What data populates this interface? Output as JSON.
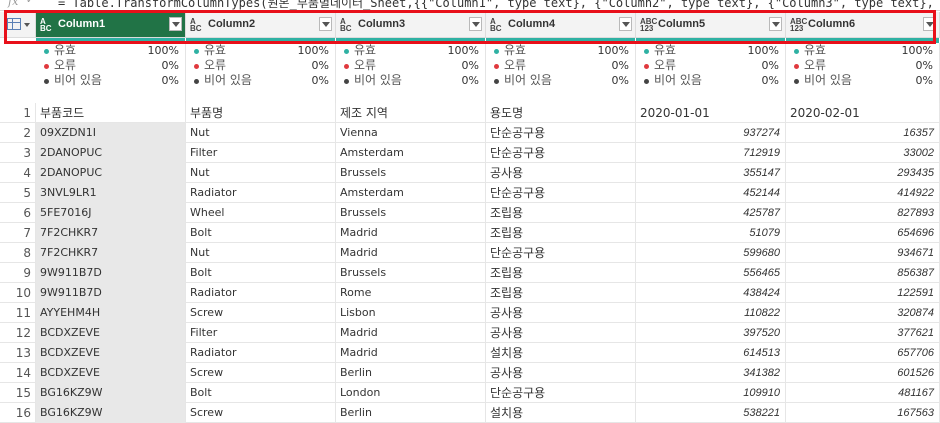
{
  "formula": {
    "fx": "fx",
    "text": "= Table.TransformColumnTypes(원본_부품별데이터_Sheet,{{\"Column1\", type text}, {\"Column2\", type text}, {\"Column3\", type text}, {\"Column4\", type text},"
  },
  "columns": [
    {
      "name": "Column1",
      "type_line1": "A",
      "type_line2": "BC",
      "type_icon": "text-type-icon"
    },
    {
      "name": "Column2",
      "type_line1": "A",
      "type_line2": "BC",
      "type_icon": "text-type-icon"
    },
    {
      "name": "Column3",
      "type_line1": "A",
      "type_line2": "BC",
      "type_icon": "text-type-icon"
    },
    {
      "name": "Column4",
      "type_line1": "A",
      "type_line2": "BC",
      "type_icon": "text-type-icon"
    },
    {
      "name": "Column5",
      "type_line1": "ABC",
      "type_line2": "123",
      "type_icon": "any-type-icon"
    },
    {
      "name": "Column6",
      "type_line1": "ABC",
      "type_line2": "123",
      "type_icon": "any-type-icon"
    }
  ],
  "profile": [
    {
      "label": "유효",
      "value": "100%",
      "color": "#2fb1a3"
    },
    {
      "label": "오류",
      "value": "0%",
      "color": "#e0393e"
    },
    {
      "label": "비어 있음",
      "value": "0%",
      "color": "#444444"
    }
  ],
  "rows": [
    {
      "n": "1",
      "c": [
        "부품코드",
        "부품명",
        "제조 지역",
        "용도명",
        "2020-01-01",
        "2020-02-01"
      ]
    },
    {
      "n": "2",
      "c": [
        "09XZDN1I",
        "Nut",
        "Vienna",
        "단순공구용",
        "937274",
        "16357"
      ]
    },
    {
      "n": "3",
      "c": [
        "2DANOPUC",
        "Filter",
        "Amsterdam",
        "단순공구용",
        "712919",
        "33002"
      ]
    },
    {
      "n": "4",
      "c": [
        "2DANOPUC",
        "Nut",
        "Brussels",
        "공사용",
        "355147",
        "293435"
      ]
    },
    {
      "n": "5",
      "c": [
        "3NVL9LR1",
        "Radiator",
        "Amsterdam",
        "단순공구용",
        "452144",
        "414922"
      ]
    },
    {
      "n": "6",
      "c": [
        "5FE7016J",
        "Wheel",
        "Brussels",
        "조립용",
        "425787",
        "827893"
      ]
    },
    {
      "n": "7",
      "c": [
        "7F2CHKR7",
        "Bolt",
        "Madrid",
        "조립용",
        "51079",
        "654696"
      ]
    },
    {
      "n": "8",
      "c": [
        "7F2CHKR7",
        "Nut",
        "Madrid",
        "단순공구용",
        "599680",
        "934671"
      ]
    },
    {
      "n": "9",
      "c": [
        "9W911B7D",
        "Bolt",
        "Brussels",
        "조립용",
        "556465",
        "856387"
      ]
    },
    {
      "n": "10",
      "c": [
        "9W911B7D",
        "Radiator",
        "Rome",
        "조립용",
        "438424",
        "122591"
      ]
    },
    {
      "n": "11",
      "c": [
        "AYYEHM4H",
        "Screw",
        "Lisbon",
        "공사용",
        "110822",
        "320874"
      ]
    },
    {
      "n": "12",
      "c": [
        "BCDXZEVE",
        "Filter",
        "Madrid",
        "공사용",
        "397520",
        "377621"
      ]
    },
    {
      "n": "13",
      "c": [
        "BCDXZEVE",
        "Radiator",
        "Madrid",
        "설치용",
        "614513",
        "657706"
      ]
    },
    {
      "n": "14",
      "c": [
        "BCDXZEVE",
        "Screw",
        "Berlin",
        "공사용",
        "341382",
        "601526"
      ]
    },
    {
      "n": "15",
      "c": [
        "BG16KZ9W",
        "Bolt",
        "London",
        "단순공구용",
        "109910",
        "481167"
      ]
    },
    {
      "n": "16",
      "c": [
        "BG16KZ9W",
        "Screw",
        "Berlin",
        "설치용",
        "538221",
        "167563"
      ]
    }
  ],
  "colors": {
    "selected_header": "#217346",
    "quality_bar": "#2fb1a3",
    "highlight": "#e8101a"
  }
}
